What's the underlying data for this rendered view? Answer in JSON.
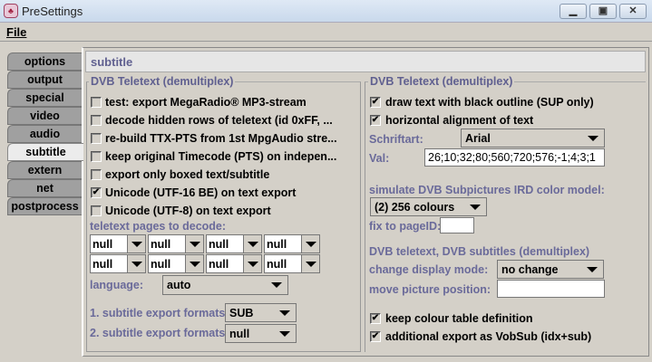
{
  "window": {
    "title": "PreSettings",
    "icon_text": "♣"
  },
  "menu": {
    "file": "File"
  },
  "tabs": [
    "options",
    "output",
    "special",
    "video",
    "audio",
    "subtitle",
    "extern",
    "net",
    "postprocess"
  ],
  "selected_tab": "subtitle",
  "header": "subtitle",
  "left_group": {
    "title": "DVB Teletext (demultiplex)",
    "checkboxes": [
      {
        "label": "test: export MegaRadio® MP3-stream",
        "checked": false
      },
      {
        "label": "decode hidden rows of teletext (id 0xFF, ...",
        "checked": false
      },
      {
        "label": "re-build TTX-PTS from 1st MpgAudio stre...",
        "checked": false
      },
      {
        "label": "keep original Timecode (PTS) on indepen...",
        "checked": false
      },
      {
        "label": "export only boxed text/subtitle",
        "checked": false
      },
      {
        "label": "Unicode (UTF-16 BE) on text export",
        "checked": true
      },
      {
        "label": "Unicode (UTF-8) on text export",
        "checked": false
      }
    ],
    "pages_label": "teletext pages to decode:",
    "pages": [
      "null",
      "null",
      "null",
      "null",
      "null",
      "null",
      "null",
      "null"
    ],
    "language_label": "language:",
    "language": "auto",
    "export1_label": "1. subtitle export formats:",
    "export1": "SUB",
    "export2_label": "2. subtitle export formats:",
    "export2": "null"
  },
  "right_group": {
    "title": "DVB Teletext (demultiplex)",
    "cb_outline": {
      "label": "draw text with black outline (SUP only)",
      "checked": true
    },
    "cb_halign": {
      "label": "horizontal alignment of text",
      "checked": true
    },
    "font_label": "Schriftart:",
    "font": "Arial",
    "val_label": "Val:",
    "val": "26;10;32;80;560;720;576;-1;4;3;1",
    "ird_label": "simulate DVB Subpictures IRD color model:",
    "ird": "(2) 256 colours",
    "pageid_label": "fix to pageID:",
    "pageid": "",
    "section2": "DVB teletext, DVB subtitles (demultiplex)",
    "display_label": "change display mode:",
    "display": "no change",
    "move_label": "move picture position:",
    "move": "",
    "cb_keep": {
      "label": "keep colour table definition",
      "checked": true
    },
    "cb_vobsub": {
      "label": "additional export as VobSub (idx+sub)",
      "checked": true
    }
  }
}
